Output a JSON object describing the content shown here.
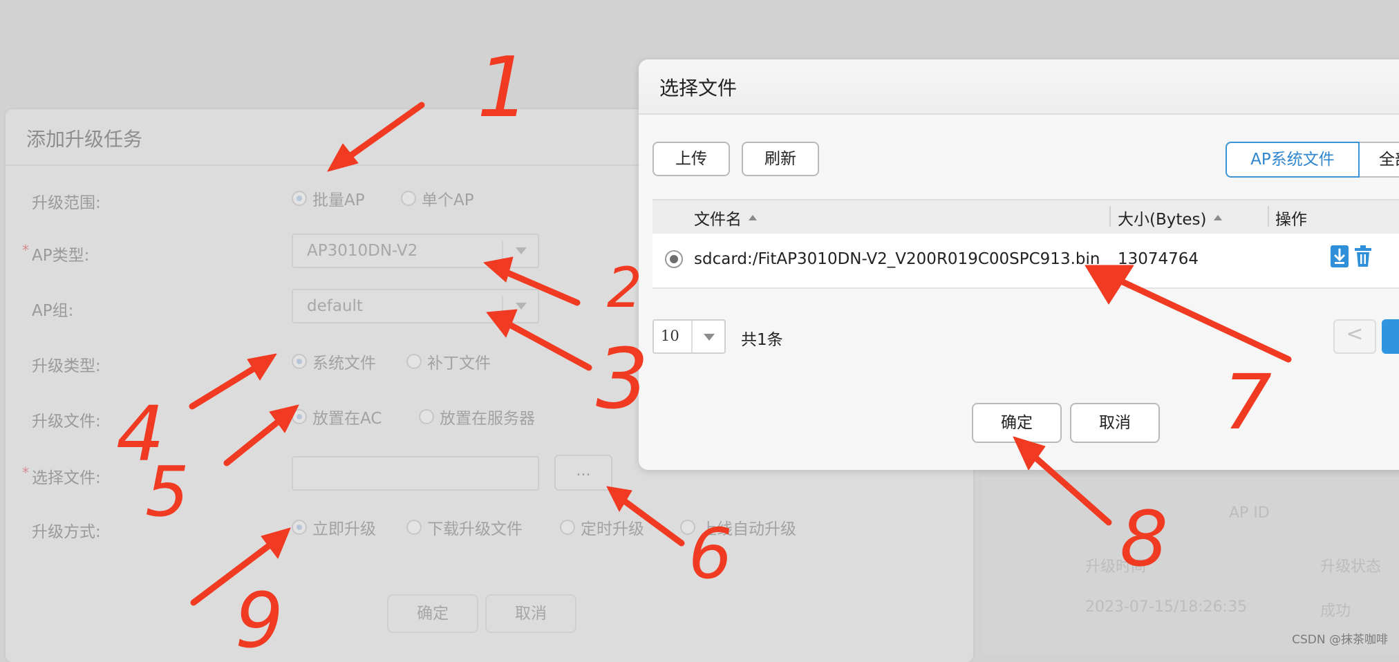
{
  "bg_dialog": {
    "title": "添加升级任务",
    "rows": {
      "scope": {
        "label": "升级范围:",
        "opt1": "批量AP",
        "opt2": "单个AP"
      },
      "ap_type": {
        "label": "AP类型:",
        "value": "AP3010DN-V2"
      },
      "ap_group": {
        "label": "AP组:",
        "value": "default"
      },
      "up_type": {
        "label": "升级类型:",
        "opt1": "系统文件",
        "opt2": "补丁文件"
      },
      "up_file": {
        "label": "升级文件:",
        "opt1": "放置在AC",
        "opt2": "放置在服务器"
      },
      "choose": {
        "label": "选择文件:",
        "browse": "..."
      },
      "method": {
        "label": "升级方式:",
        "opt1": "立即升级",
        "opt2": "下载升级文件",
        "opt3": "定时升级",
        "opt4": "上线自动升级"
      }
    },
    "required_mark": "*",
    "confirm": "确定",
    "cancel": "取消"
  },
  "bg_right": {
    "ap_id": "AP ID",
    "col_time": "升级时间",
    "col_status": "升级状态",
    "row_time": "2023-07-15/18:26:35",
    "row_status": "成功"
  },
  "file_modal": {
    "title": "选择文件",
    "upload": "上传",
    "refresh": "刷新",
    "tab_active": "AP系统文件",
    "tab_next": "全部",
    "columns": {
      "name": "文件名",
      "size": "大小(Bytes)",
      "ops": "操作"
    },
    "row": {
      "name": "sdcard:/FitAP3010DN-V2_V200R019C00SPC913.bin",
      "size": "13074764"
    },
    "page_size": "10",
    "total": "共1条",
    "prev": "<",
    "confirm": "确定",
    "cancel": "取消"
  },
  "annotations": {
    "n1": "1",
    "n2": "2",
    "n3": "3",
    "n4": "4",
    "n5": "5",
    "n6": "6",
    "n7": "7",
    "n8": "8",
    "n9": "9",
    "color": "#f03a22"
  },
  "watermark": "CSDN @抹茶咖啡"
}
